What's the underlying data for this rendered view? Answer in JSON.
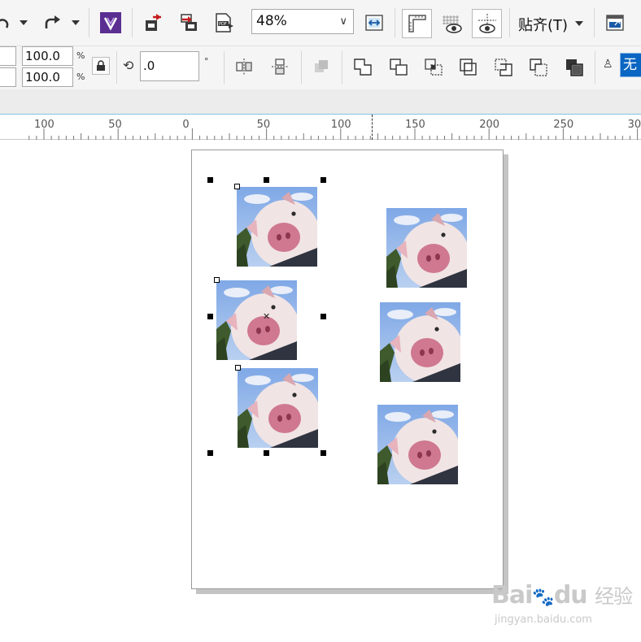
{
  "toolbar": {
    "undo_icon": "undo-arrow-icon",
    "redo_icon": "redo-arrow-icon",
    "zoom_value": "48%",
    "snap_label": "贴齐(T)"
  },
  "transform": {
    "scale_x": "100.0",
    "scale_y": "100.0",
    "percent_symbol": "%",
    "rotation": ".0",
    "degree_symbol": "°",
    "fill_none": "无"
  },
  "ruler": {
    "ticks": [
      "100",
      "50",
      "0",
      "50",
      "100",
      "150",
      "200",
      "250",
      "30"
    ]
  },
  "watermark": {
    "brand": "Bai",
    "brand_du": "du",
    "brand_cn": "经验",
    "url": "jingyan.baidu.com"
  },
  "colors": {
    "accent_blue": "#0a66c2",
    "corel_purple": "#5b2e91",
    "ruler_line": "#7ec3ea"
  }
}
